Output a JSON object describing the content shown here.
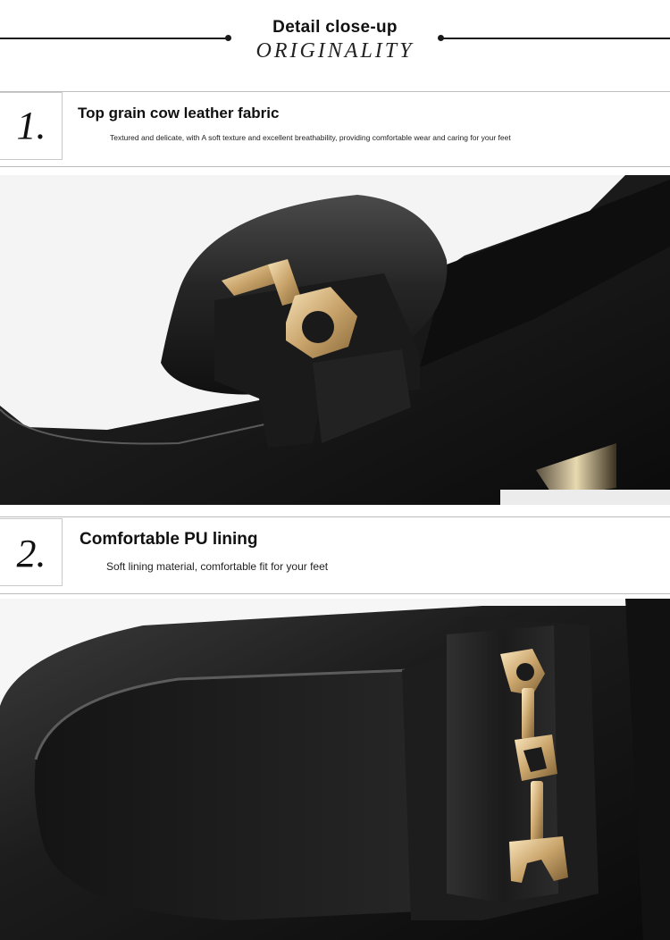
{
  "header": {
    "title": "Detail close-up",
    "subtitle": "ORIGINALITY"
  },
  "features": [
    {
      "number": "1.",
      "title": "Top grain cow leather fabric",
      "description": "Textured and delicate, with A soft texture and excellent breathability, providing comfortable wear and caring for your feet"
    },
    {
      "number": "2.",
      "title": "Comfortable PU lining",
      "description": "Soft lining material, comfortable fit for your feet"
    }
  ],
  "colors": {
    "leather": "#141414",
    "gold_hardware": "#c9a46b",
    "rule": "#bdbdbd"
  }
}
